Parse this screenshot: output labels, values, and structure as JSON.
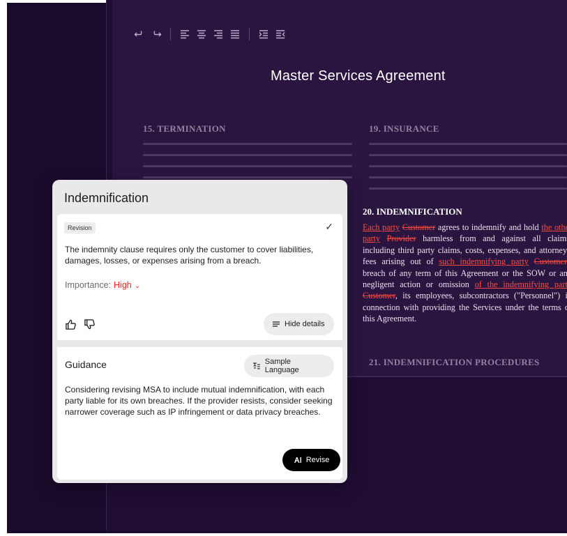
{
  "toolbar": {
    "icons": [
      "undo-icon",
      "redo-icon",
      "align-left-icon",
      "align-center-icon",
      "align-right-icon",
      "align-justify-icon",
      "indent-icon",
      "outdent-icon"
    ]
  },
  "document": {
    "title": "Master Services Agreement",
    "sections": {
      "s15": "15. TERMINATION",
      "s19": "19. INSURANCE",
      "s20": "20. INDEMNIFICATION",
      "s21": "21. INDEMNIFICATION PROCEDURES"
    },
    "clause": {
      "ins1": "Each party",
      "del1": "Customer",
      "t1": " agrees to indemnify and hold ",
      "ins2": "the other party",
      "del2": "Provider",
      "t2": " harmless from and against all claims, including third party claims, costs, expenses, and attorneys' fees arising out of ",
      "ins3": "such indemnifying party",
      "del3": "Customer",
      "t3": "'s breach of any term of this Agreement or the SOW or any negligent action or omission ",
      "ins4": "of the indemnifying party",
      "del4": "Customer",
      "t4": ", its employees, subcontractors (\"Personnel\") in connection with providing the Services under the terms of this Agreement."
    }
  },
  "card": {
    "title": "Indemnification",
    "badge": "Revision",
    "check": "✓",
    "description": "The indemnity clause requires only the customer to cover liabilities, damages, losses, or expenses arising from a breach.",
    "importance_label": "Importance:",
    "importance_value": "High",
    "hide_details": "Hide details",
    "guidance_title": "Guidance",
    "sample_language": "Sample Language",
    "guidance_text": "Considering revising MSA to include mutual indemnification, with each party liable for its own breaches. If the provider resists, consider seeking narrower coverage such as IP infringement or data privacy breaches.",
    "revise": "Revise"
  },
  "colors": {
    "background": "#1a0a2c",
    "page": "#2a1540",
    "accent_red": "#e8231d",
    "redline": "#ff4a3d"
  }
}
